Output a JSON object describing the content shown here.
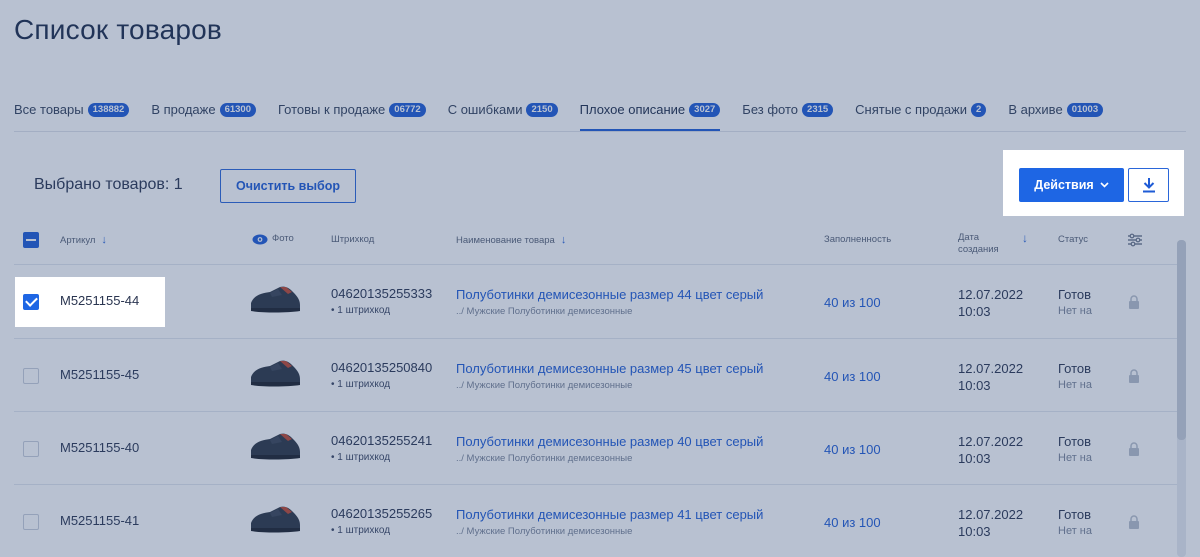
{
  "page": {
    "title": "Список товаров"
  },
  "tabs": [
    {
      "label": "Все товары",
      "count": "138882",
      "active": false
    },
    {
      "label": "В продаже",
      "count": "61300",
      "active": false
    },
    {
      "label": "Готовы к продаже",
      "count": "06772",
      "active": false
    },
    {
      "label": "С ошибками",
      "count": "2150",
      "active": false
    },
    {
      "label": "Плохое описание",
      "count": "3027",
      "active": true
    },
    {
      "label": "Без фото",
      "count": "2315",
      "active": false
    },
    {
      "label": "Снятые с продажи",
      "count": "2",
      "active": false
    },
    {
      "label": "В архиве",
      "count": "01003",
      "active": false
    }
  ],
  "toolbar": {
    "selected_label": "Выбрано товаров: 1",
    "clear_label": "Очистить выбор",
    "actions_label": "Действия",
    "download_icon": "download-icon"
  },
  "table": {
    "headers": {
      "sku": "Артикул",
      "photo": "Фото",
      "barcode": "Штрихкод",
      "name": "Наименование товара",
      "score": "Заполненность",
      "date_line1": "Дата",
      "date_line2": "создания",
      "status": "Статус"
    },
    "rows": [
      {
        "checked": true,
        "sku": "M5251155-44",
        "barcode": "04620135255333",
        "barcode_sub": "• 1 штрихкод",
        "name": "Полуботинки демисезонные размер 44 цвет серый",
        "category": "../ Мужские Полуботинки демисезонные",
        "score": "40 из 100",
        "date": "12.07.2022",
        "time": "10:03",
        "status": "Готов",
        "status_sub": "Нет на"
      },
      {
        "checked": false,
        "sku": "M5251155-45",
        "barcode": "04620135250840",
        "barcode_sub": "• 1 штрихкод",
        "name": "Полуботинки демисезонные размер 45 цвет серый",
        "category": "../ Мужские Полуботинки демисезонные",
        "score": "40 из 100",
        "date": "12.07.2022",
        "time": "10:03",
        "status": "Готов",
        "status_sub": "Нет на"
      },
      {
        "checked": false,
        "sku": "M5251155-40",
        "barcode": "04620135255241",
        "barcode_sub": "• 1 штрихкод",
        "name": "Полуботинки демисезонные размер 40 цвет серый",
        "category": "../ Мужские Полуботинки демисезонные",
        "score": "40 из 100",
        "date": "12.07.2022",
        "time": "10:03",
        "status": "Готов",
        "status_sub": "Нет на"
      },
      {
        "checked": false,
        "sku": "M5251155-41",
        "barcode": "04620135255265",
        "barcode_sub": "• 1 штрихкод",
        "name": "Полуботинки демисезонные размер 41 цвет серый",
        "category": "../ Мужские Полуботинки демисезонные",
        "score": "40 из 100",
        "date": "12.07.2022",
        "time": "10:03",
        "status": "Готов",
        "status_sub": "Нет на"
      }
    ]
  },
  "colors": {
    "accent": "#1e5bd6",
    "overlay": "#2e4a78",
    "text": "#1b2a48"
  }
}
